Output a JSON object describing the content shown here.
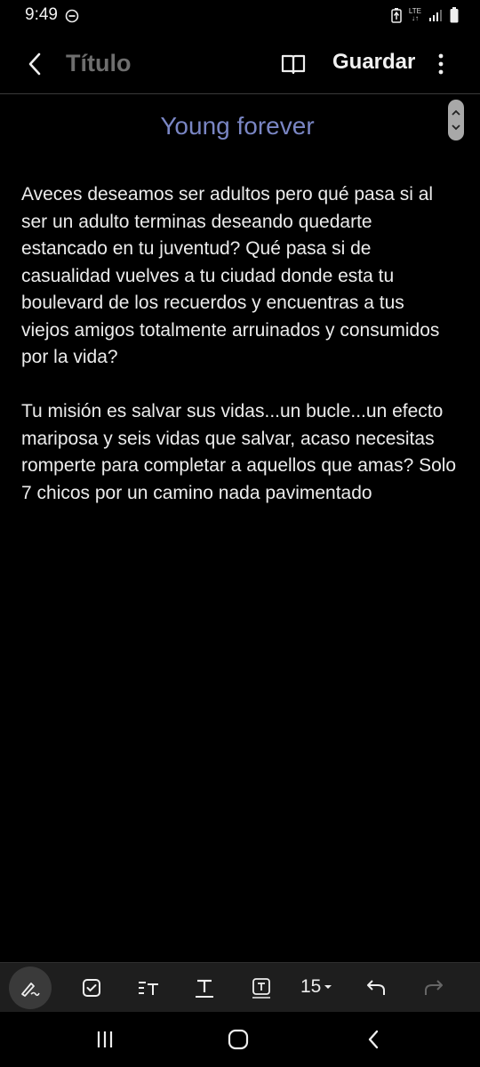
{
  "status_bar": {
    "time": "9:49",
    "network": "LTE",
    "icons": [
      "do-not-disturb-icon",
      "battery-saver-icon",
      "signal-icon",
      "battery-icon"
    ]
  },
  "app_bar": {
    "title_placeholder": "Título",
    "save_label": "Guardar",
    "icons": [
      "back-icon",
      "book-icon",
      "more-icon"
    ]
  },
  "document": {
    "title": "Young forever",
    "paragraphs": [
      "Aveces deseamos ser adultos pero qué pasa si al ser un adulto terminas deseando quedarte estancado en tu juventud? Qué pasa si de casualidad vuelves a tu ciudad donde esta tu boulevard de los recuerdos y encuentras a tus viejos amigos totalmente arruinados y consumidos por la vida?",
      "Tu misión es salvar sus vidas...un bucle...un efecto mariposa y seis vidas que salvar, acaso necesitas romperte para completar a aquellos que amas? Solo 7 chicos por un camino nada pavimentado"
    ]
  },
  "toolbar": {
    "font_size": "15",
    "icons": [
      "handwriting-pen-icon",
      "checkbox-icon",
      "paragraph-style-icon",
      "text-format-icon",
      "text-box-icon",
      "undo-icon",
      "redo-icon"
    ]
  },
  "nav_bar": {
    "icons": [
      "recent-apps-icon",
      "home-icon",
      "back-nav-icon"
    ]
  },
  "colors": {
    "background": "#000000",
    "title_accent": "#7a86c4",
    "toolbar_bg": "#1e1e1e"
  }
}
